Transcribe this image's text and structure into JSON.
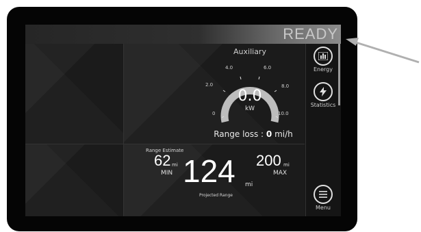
{
  "status": {
    "ready": "READY"
  },
  "auxiliary": {
    "title": "Auxiliary",
    "ticks": {
      "t0": "0",
      "t2": "2.0",
      "t4": "4.0",
      "t6": "6.0",
      "t8": "8.0",
      "t10": "10.0"
    },
    "value": "0.0",
    "unit": "kW",
    "level_fraction": 0.0
  },
  "range_loss": {
    "label": "Range loss : ",
    "value": "0",
    "unit": " mi/h"
  },
  "range_estimate": {
    "label": "Range Estimate",
    "min_value": "62",
    "min_unit": "mi",
    "min_label": "MIN",
    "projected_value": "124",
    "projected_unit": "mi",
    "projected_label": "Projected Range",
    "max_value": "200",
    "max_unit": "mi",
    "max_label": "MAX"
  },
  "sidebar": {
    "energy_label": "Energy",
    "statistics_label": "Statistics",
    "menu_label": "Menu"
  },
  "icons": {
    "energy": "bar-chart-icon",
    "statistics": "lightning-bolt-icon",
    "menu": "hamburger-menu-icon",
    "pointer": "pointer-arrow"
  },
  "colors": {
    "screen_bg": "#181818",
    "bezel": "#050505",
    "text": "#ffffff",
    "arrow": "#b0b0b0"
  }
}
